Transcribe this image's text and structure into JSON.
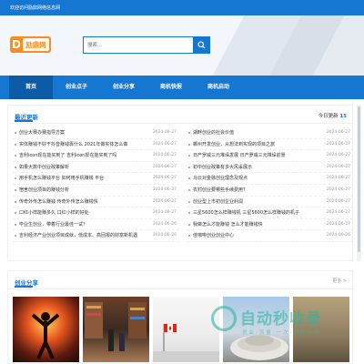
{
  "top": {
    "welcome": "欢迎访问励鼎网络信息网"
  },
  "logo": {
    "mark": "D",
    "text": "励鼎网"
  },
  "search": {
    "placeholder": "搜索..."
  },
  "nav": [
    "首页",
    "创业点子",
    "创业分享",
    "商机快报",
    "商机启动"
  ],
  "latest": {
    "title": "最近更新",
    "today_label": "今日更新",
    "today_count": "15",
    "left": [
      {
        "t": "创业大赛办赛指导方案",
        "d": "2024-06-27"
      },
      {
        "t": "实体赚钱不好干抖音赚钱靠什么 2021年做实体怎么做",
        "d": "2024-06-27"
      },
      {
        "t": "吉利icon现在能买到了 吉利icon现在能买到了吗",
        "d": "2024-06-27"
      },
      {
        "t": "如果大数中创业政策解析",
        "d": "2024-06-27"
      },
      {
        "t": "用手机怎么赚钱平台 如何用手机赚钱 平台",
        "d": "2024-06-27"
      },
      {
        "t": "宿舍创业项目的赚钱分析",
        "d": "2024-06-27"
      },
      {
        "t": "传奇外传怎么赚钱 传奇外传怎么赚钱快",
        "d": "2024-06-27"
      },
      {
        "t": "口红小样能赚多久 口红小样的好处",
        "d": "2024-06-27"
      },
      {
        "t": "毕业生创业，带着行业最佳一试？",
        "d": "2024-06-26"
      },
      {
        "t": "吉利经济产业创业项目成就，低成本、高回报的财富新机遇",
        "d": "2024-06-26"
      }
    ],
    "right": [
      {
        "t": "湖畔创业的社会价值",
        "d": "2024-06-27"
      },
      {
        "t": "郴州开发创业，从想法到实现的项目之旅",
        "d": "2024-06-27"
      },
      {
        "t": "日产罗威三元堆垛发展 日产罗威三元堆垛前景",
        "d": "2024-06-27"
      },
      {
        "t": "初中创业政策有多大风采展示",
        "d": "2024-06-27"
      },
      {
        "t": "马云对金融创业理念及观点",
        "d": "2024-06-27"
      },
      {
        "t": "农村创业要哪些手续费用？",
        "d": "2024-06-27"
      },
      {
        "t": "创业型上市初创企业利润",
        "d": "2024-06-27"
      },
      {
        "t": "三星5600怎么样赚钱机 三星5600怎么样赚钱的机子",
        "d": "2024-06-27"
      },
      {
        "t": "我做怎么才能赚钱 怎么才能赚钱快",
        "d": "2024-06-27"
      },
      {
        "t": "佳咖啡创业创业中心",
        "d": "2024-06-26"
      }
    ]
  },
  "share": {
    "title": "创业分享",
    "more": "更多 >"
  },
  "watermark": {
    "text": "自动秒收录",
    "sub": "创业·流量·一次·自动收录"
  },
  "colors": {
    "primary": "#1677d2",
    "logo": "#ff8c1a",
    "watermark": "#2eb5a0"
  }
}
